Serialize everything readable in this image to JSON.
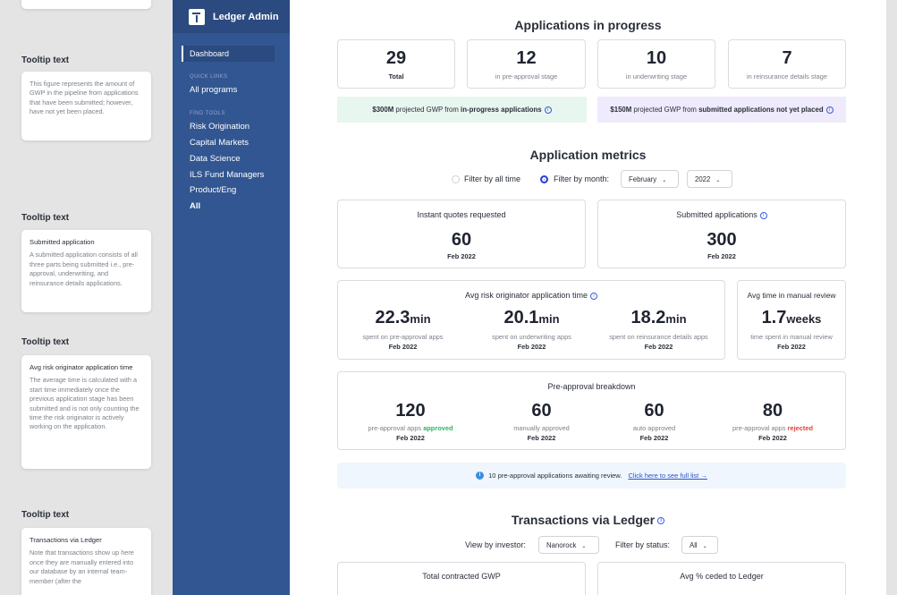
{
  "tooltips": [
    {
      "title": "Tooltip text",
      "body": "This figure represents the amount of GWP in the pipeline from applications that have been submitted; however, have not yet been placed."
    },
    {
      "title": "Tooltip text",
      "heading": "Submitted application",
      "body": "A submitted application consists of all three parts being submitted i.e., pre-approval, underwriting, and reinsurance details applications."
    },
    {
      "title": "Tooltip text",
      "heading": "Avg risk originator application time",
      "body": "The average time is calculated with a start time immediately once the previous application stage has been submitted and is not only counting the time the risk originator is actively working on the application."
    },
    {
      "title": "Tooltip text",
      "heading": "Transactions via Ledger",
      "body": "Note that transactions show up here once they are manually entered into our database by an internal team-member (after the"
    }
  ],
  "nav": {
    "brand": "Ledger Admin",
    "selected": "Dashboard",
    "quick_links_label": "QUICK LINKS",
    "all_programs": "All programs",
    "find_tools_label": "FIND TOOLS",
    "tools": [
      "Risk Origination",
      "Capital Markets",
      "Data Science",
      "ILS Fund Managers",
      "Product/Eng",
      "All"
    ]
  },
  "progress": {
    "title": "Applications in progress",
    "stats": [
      {
        "value": "29",
        "label": "Total"
      },
      {
        "value": "12",
        "label": "in pre-approval stage"
      },
      {
        "value": "10",
        "label": "in underwriting stage"
      },
      {
        "value": "7",
        "label": "in reinsurance details stage"
      }
    ],
    "banner1": {
      "amount": "$300M",
      "text": " projected GWP from ",
      "bold": "in-progress applications"
    },
    "banner2": {
      "amount": "$150M",
      "text": " projected GWP from ",
      "bold": "submitted applications not yet placed"
    }
  },
  "metrics": {
    "title": "Application metrics",
    "filter_all": "Filter by all time",
    "filter_month": "Filter by month:",
    "month": "February",
    "year": "2022",
    "instant": {
      "label": "Instant quotes requested",
      "value": "60",
      "date": "Feb 2022"
    },
    "submitted": {
      "label": "Submitted applications",
      "value": "300",
      "date": "Feb 2022"
    },
    "avg_title": "Avg risk originator application time",
    "avg": [
      {
        "value": "22.3",
        "unit": "min",
        "label": "spent on pre-approval apps",
        "date": "Feb 2022"
      },
      {
        "value": "20.1",
        "unit": "min",
        "label": "spent on underwriting apps",
        "date": "Feb 2022"
      },
      {
        "value": "18.2",
        "unit": "min",
        "label": "spent on reinsurance details apps",
        "date": "Feb 2022"
      }
    ],
    "manual": {
      "title": "Avg time in manual review",
      "value": "1.7",
      "unit": "weeks",
      "label": "time spent in manual review",
      "date": "Feb 2022"
    },
    "breakdown_title": "Pre-approval breakdown",
    "breakdown": [
      {
        "value": "120",
        "label": "pre-approval apps ",
        "flag": "approved",
        "date": "Feb 2022"
      },
      {
        "value": "60",
        "label": "manually approved",
        "date": "Feb 2022"
      },
      {
        "value": "60",
        "label": "auto approved",
        "date": "Feb 2022"
      },
      {
        "value": "80",
        "label": "pre-approval apps ",
        "flag": "rejected",
        "date": "Feb 2022"
      }
    ],
    "alert": {
      "text": "10 pre-approval applications awaiting review. ",
      "link": "Click here to see full list →"
    }
  },
  "transactions": {
    "title": "Transactions via Ledger",
    "investor_label": "View by investor:",
    "investor": "Nanorock",
    "status_label": "Filter by status:",
    "status": "All",
    "card1": "Total contracted GWP",
    "card2": "Avg % ceded to Ledger"
  }
}
